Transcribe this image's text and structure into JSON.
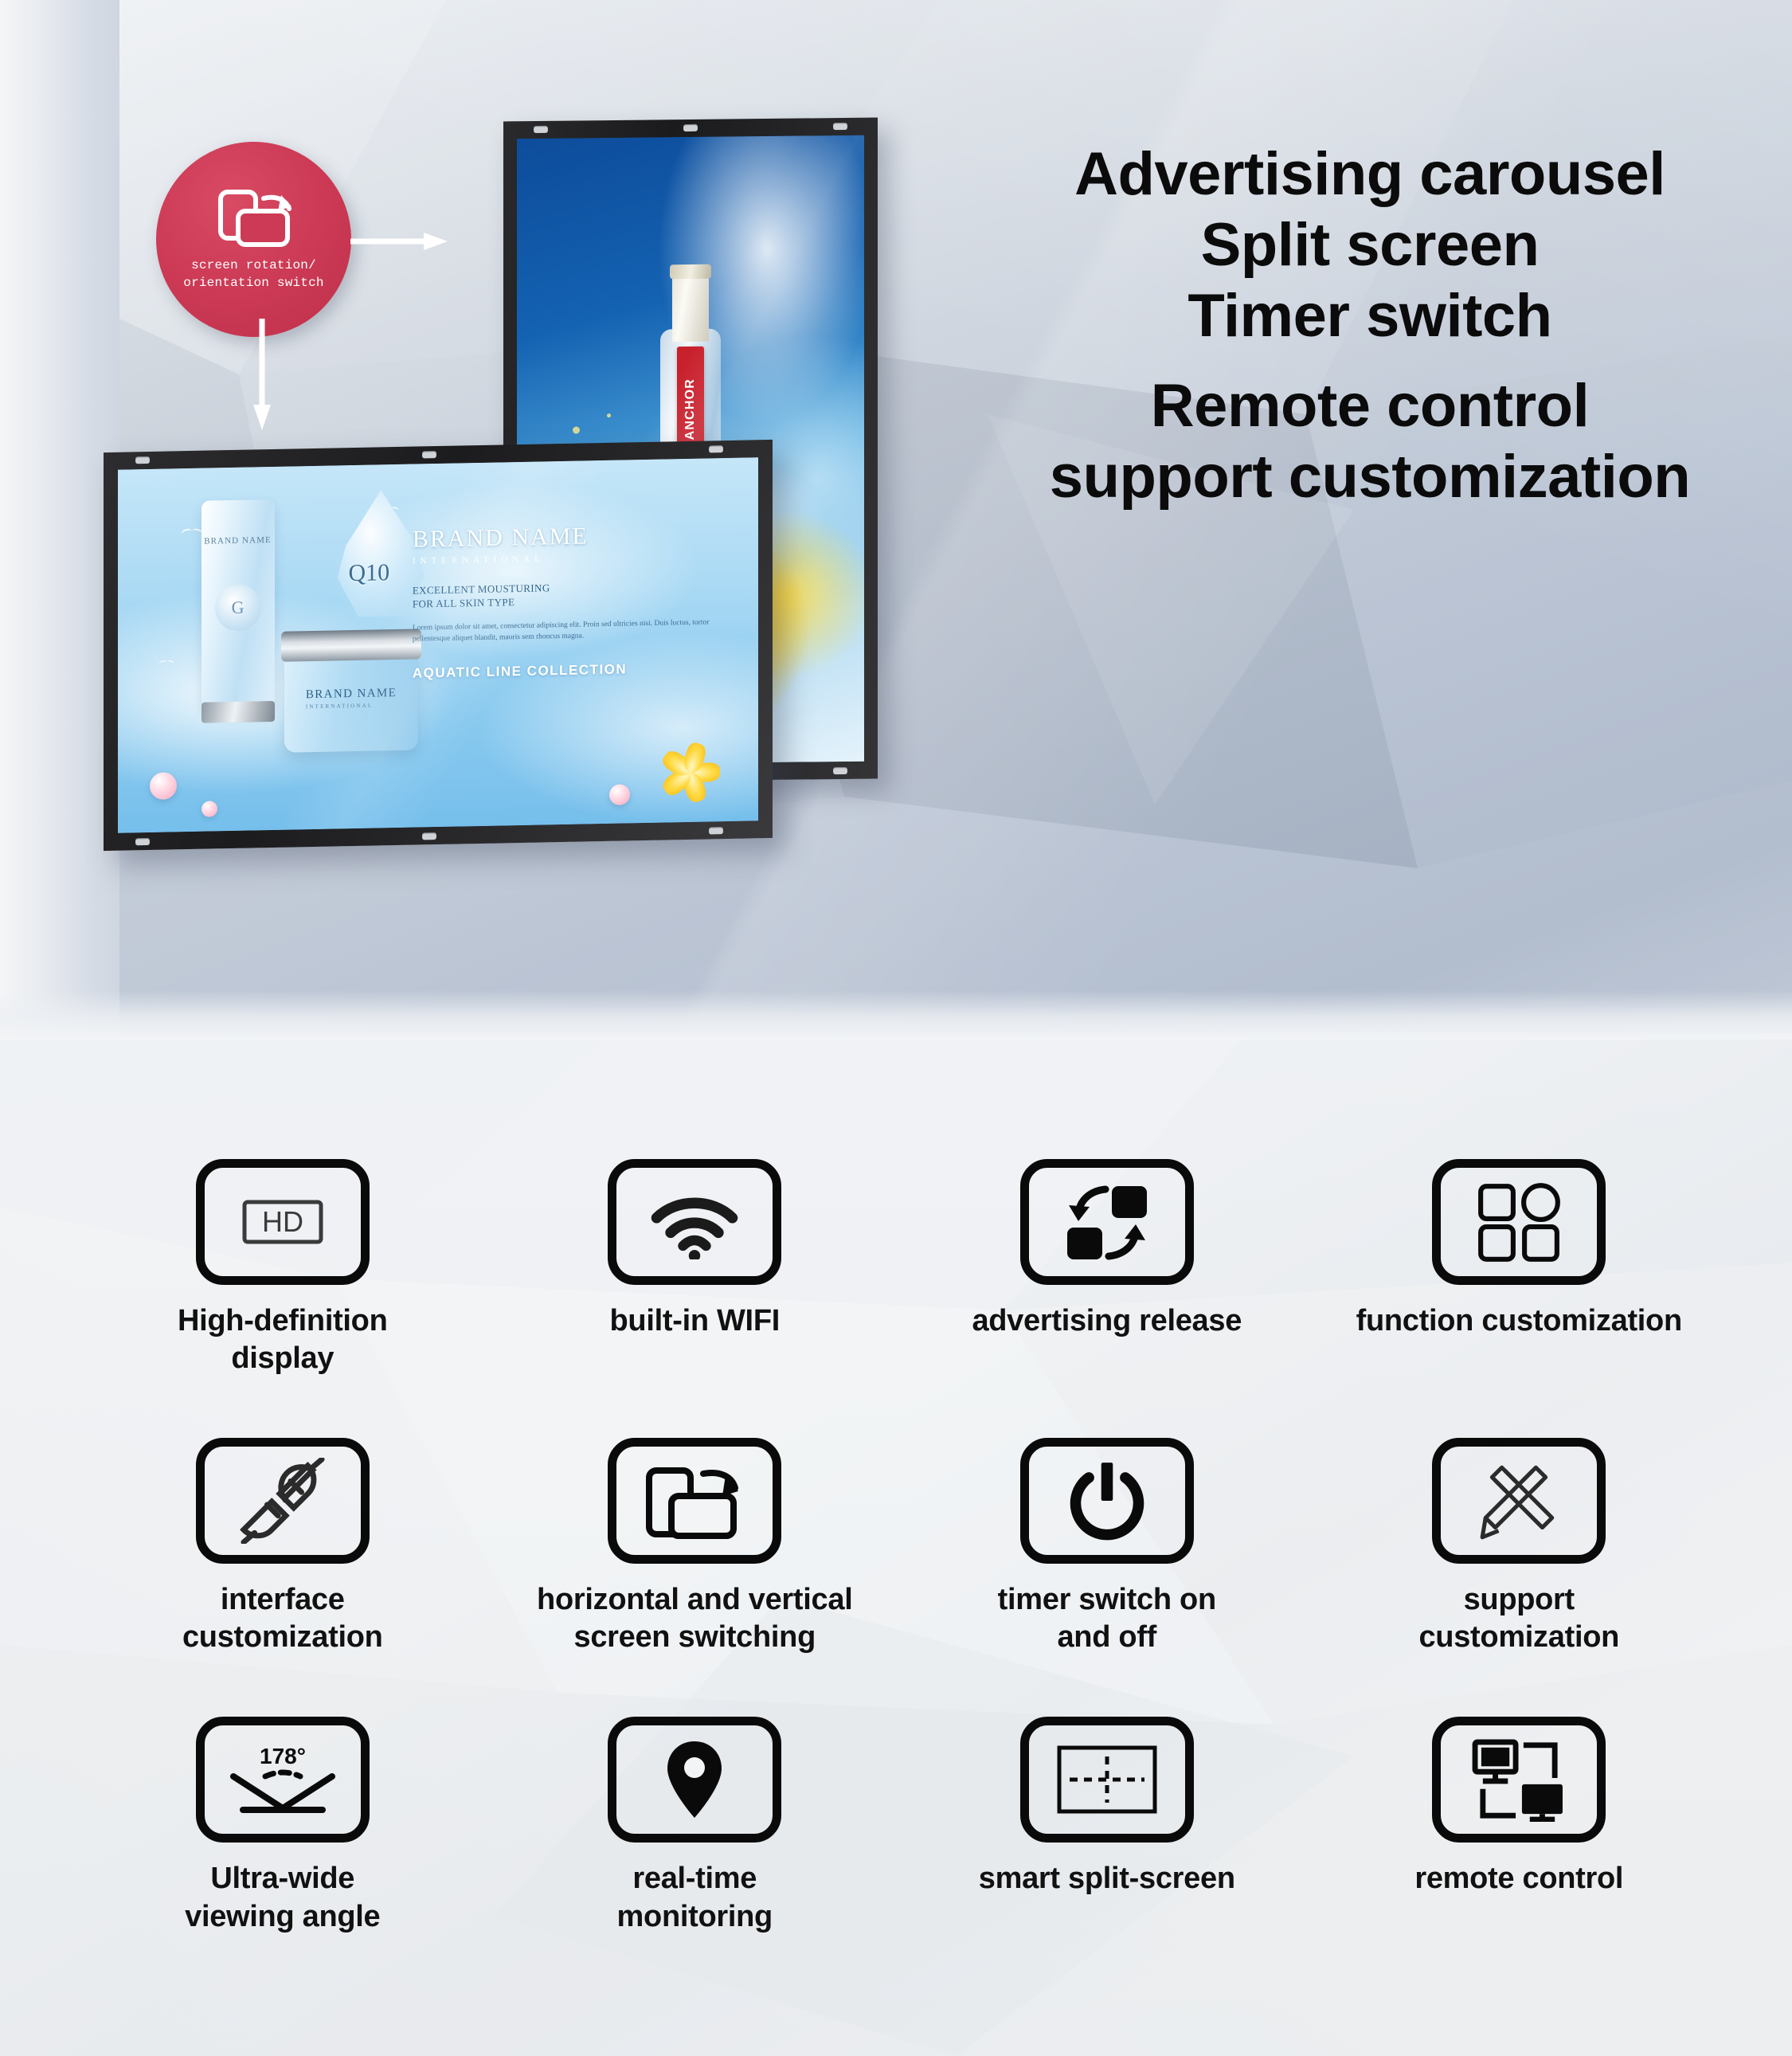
{
  "hero": {
    "headlines": [
      "Advertising carousel",
      "Split screen",
      "Timer switch",
      "Remote control",
      "support customization"
    ],
    "badge": {
      "icon": "screen-rotation-icon",
      "caption_line1": "screen rotation/",
      "caption_line2": "orientation switch",
      "color": "#c8304a"
    },
    "portrait_display": {
      "ad_type": "beverage-advertisement",
      "brand_label": "ANCHOR",
      "label_color": "#c8202c",
      "background": "blue sky with golden beer splash"
    },
    "landscape_display": {
      "ad_type": "cosmetics-advertisement",
      "brand_title": "BRAND NAME",
      "brand_sub": "INTERNATIONAL",
      "heading_line1": "EXCELLENT MOUSTURING",
      "heading_line2": "FOR ALL SKIN TYPE",
      "body": "Lorem ipsum dolor sit amet, consectetur adipiscing elit. Proin sed ultricies nisi. Duis luctus, tortor pellentesque aliquet blandit, mauris sem rhoncus magna.",
      "footer": "AQUATIC LINE COLLECTION",
      "tube_brand": "BRAND NAME",
      "tube_seal": "G",
      "drop_label": "Q10",
      "jar_brand": "BRAND NAME",
      "jar_brand_sub": "INTERNATIONAL"
    }
  },
  "features": {
    "items": [
      {
        "icon": "hd-icon",
        "icon_text": "HD",
        "label": "High-definition\ndisplay"
      },
      {
        "icon": "wifi-icon",
        "icon_text": "",
        "label": "built-in WIFI"
      },
      {
        "icon": "content-release-icon",
        "icon_text": "",
        "label": "advertising release"
      },
      {
        "icon": "app-grid-icon",
        "icon_text": "",
        "label": "function customization"
      },
      {
        "icon": "plug-connector-icon",
        "icon_text": "",
        "label": "interface\ncustomization"
      },
      {
        "icon": "screen-rotation-icon",
        "icon_text": "",
        "label": "horizontal and vertical\nscreen switching"
      },
      {
        "icon": "power-icon",
        "icon_text": "",
        "label": "timer switch on\nand off"
      },
      {
        "icon": "pencil-ruler-icon",
        "icon_text": "",
        "label": "support\ncustomization"
      },
      {
        "icon": "viewing-angle-icon",
        "icon_text": "178°",
        "label": "Ultra-wide\nviewing angle"
      },
      {
        "icon": "location-pin-icon",
        "icon_text": "",
        "label": "real-time\nmonitoring"
      },
      {
        "icon": "split-screen-icon",
        "icon_text": "",
        "label": "smart split-screen"
      },
      {
        "icon": "network-monitors-icon",
        "icon_text": "",
        "label": "remote control"
      }
    ]
  },
  "colors": {
    "hero_gradient_start": "#eef1f4",
    "hero_gradient_end": "#aab6c9",
    "badge_red": "#c8304a",
    "icon_stroke": "#0a0a0a",
    "text_primary": "#111111",
    "features_bg": "#f3f4f6"
  }
}
